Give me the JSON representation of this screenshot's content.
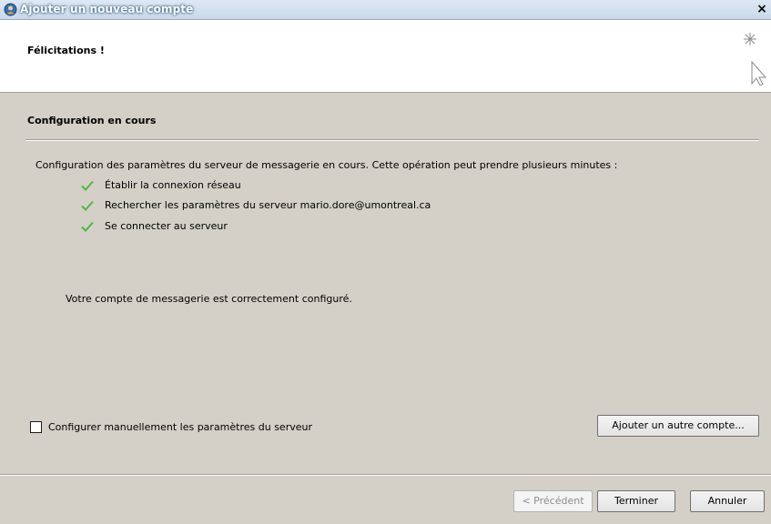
{
  "window": {
    "title": "Ajouter un nouveau compte",
    "close_label": "×"
  },
  "header": {
    "title": "Félicitations !",
    "icon": "wizard-cursor-icon"
  },
  "section": {
    "title": "Configuration en cours",
    "description": "Configuration des paramètres du serveur de messagerie en cours. Cette opération peut prendre plusieurs minutes :",
    "steps": [
      {
        "label": "Établir la connexion réseau",
        "status": "done"
      },
      {
        "label": "Rechercher les paramètres du serveur mario.dore@umontreal.ca",
        "status": "done"
      },
      {
        "label": "Se connecter au serveur",
        "status": "done"
      }
    ],
    "success_message": "Votre compte de messagerie est correctement configuré."
  },
  "options": {
    "manual_config_label": "Configurer manuellement les paramètres du serveur",
    "manual_config_checked": false,
    "add_another_label": "Ajouter un autre compte..."
  },
  "footer": {
    "previous_label": "< Précédent",
    "finish_label": "Terminer",
    "cancel_label": "Annuler"
  },
  "colors": {
    "check": "#4fb83f",
    "dialog_bg": "#d4d0c8"
  }
}
